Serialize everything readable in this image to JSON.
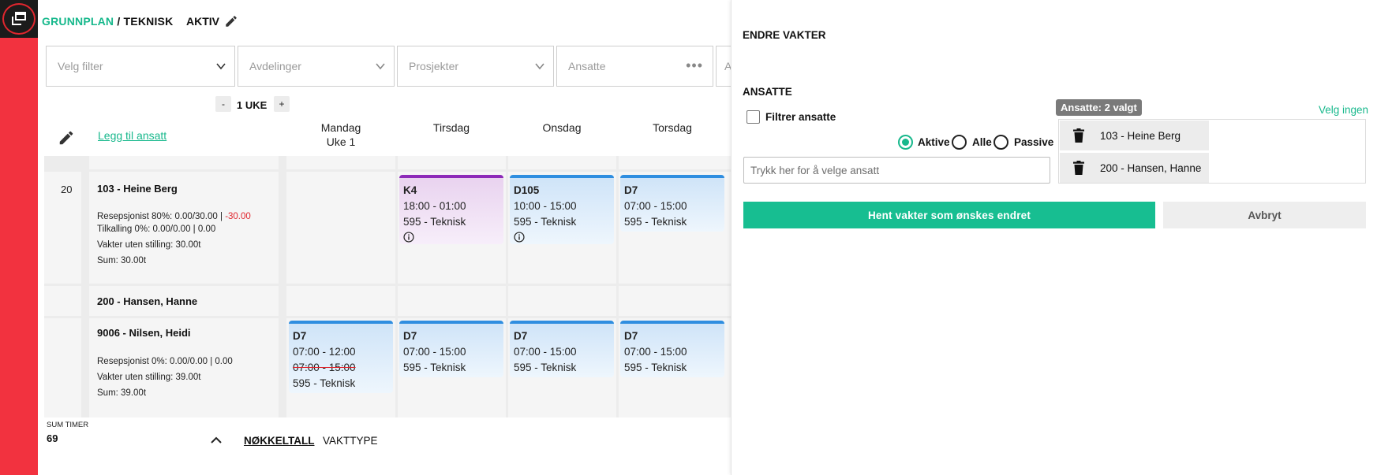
{
  "header": {
    "crumb_plan": "GRUNNPLAN",
    "crumb_sep": " / ",
    "crumb_dept": "TEKNISK",
    "status": "AKTIV"
  },
  "filters": [
    {
      "placeholder": "Velg filter",
      "icon": "chevron-down-icon"
    },
    {
      "placeholder": "Avdelinger",
      "icon": "chevron-down-icon"
    },
    {
      "placeholder": "Prosjekter",
      "icon": "chevron-down-icon"
    },
    {
      "placeholder": "Ansatte",
      "icon": "more-dots-icon"
    },
    {
      "placeholder": "A"
    }
  ],
  "week": {
    "minus": "-",
    "label": "1 UKE",
    "plus": "+"
  },
  "add_employee": "Legg til ansatt",
  "days": [
    {
      "name": "Mandag",
      "sub": "Uke 1"
    },
    {
      "name": "Tirsdag",
      "sub": ""
    },
    {
      "name": "Onsdag",
      "sub": ""
    },
    {
      "name": "Torsdag",
      "sub": ""
    }
  ],
  "rows": [
    {
      "num": "20",
      "name": "103 - Heine Berg",
      "line1_a": "Resepsjonist 80%: 0.00/30.00 | ",
      "line1_neg": "-30.00",
      "line2": "Tilkalling 0%: 0.00/0.00 | 0.00",
      "line3": "Vakter uten stilling: 30.00t",
      "line4": "Sum: 30.00t"
    },
    {
      "num": "",
      "name": "200 - Hansen, Hanne"
    },
    {
      "num": "",
      "name": "9006 - Nilsen, Heidi",
      "line1": "Resepsjonist 0%: 0.00/0.00 | 0.00",
      "line2": "Vakter uten stilling: 39.00t",
      "line3": "Sum: 39.00t"
    }
  ],
  "shifts_row1": [
    {
      "code": "K4",
      "time": "18:00 - 01:00",
      "dept": "595 - Teknisk",
      "color": "#8d2bb8"
    },
    {
      "code": "D105",
      "time": "10:00 - 15:00",
      "dept": "595 - Teknisk",
      "color": "#2f8ee0"
    },
    {
      "code": "D7",
      "time": "07:00 - 15:00",
      "dept": "595 - Teknisk",
      "color": "#2f8ee0"
    }
  ],
  "shifts_row3": [
    {
      "code": "D7",
      "time": "07:00 - 12:00",
      "old_time": "07:00 - 15:00",
      "dept": "595 - Teknisk"
    },
    {
      "code": "D7",
      "time": "07:00 - 15:00",
      "dept": "595 - Teknisk"
    },
    {
      "code": "D7",
      "time": "07:00 - 15:00",
      "dept": "595 - Teknisk"
    },
    {
      "code": "D7",
      "time": "07:00 - 15:00",
      "dept": "595 - Teknisk"
    }
  ],
  "footer": {
    "sum_label": "SUM TIMER",
    "sum_value": "69",
    "tab_key": "NØKKELTALL",
    "tab_type": "VAKTTYPE"
  },
  "panel": {
    "title": "ENDRE VAKTER",
    "section": "ANSATTE",
    "filter_label": "Filtrer ansatte",
    "radio_active": "Aktive",
    "radio_all": "Alle",
    "radio_passive": "Passive",
    "input_placeholder": "Trykk her for å velge ansatt",
    "badge": "Ansatte: 2 valgt",
    "clear_link": "Velg ingen",
    "selected": [
      "103 - Heine Berg",
      "200 - Hansen, Hanne"
    ],
    "primary_button": "Hent vakter som ønskes endret",
    "cancel_button": "Avbryt"
  },
  "colors": {
    "brand_red": "#f2323f",
    "accent_green": "#17b88c",
    "shift_blue": "#2f8ee0",
    "shift_purple": "#8d2bb8",
    "negative": "#e0262e"
  }
}
